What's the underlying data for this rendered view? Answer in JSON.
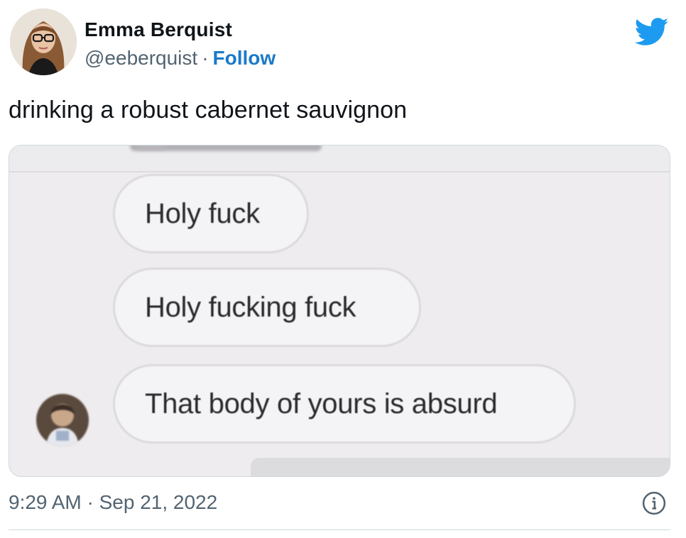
{
  "author": {
    "display_name": "Emma Berquist",
    "handle": "@eeberquist",
    "separator": "·",
    "follow_label": "Follow"
  },
  "tweet": {
    "text": "drinking a robust cabernet sauvignon",
    "timestamp": "9:29 AM · Sep 21, 2022"
  },
  "media": {
    "messages": [
      "Holy fuck",
      "Holy fucking fuck",
      "That body of yours is absurd"
    ]
  },
  "icons": {
    "brand": "twitter-bird-icon",
    "info": "info-icon"
  },
  "colors": {
    "brand_blue": "#1d9bf0",
    "link_blue": "#1b7ac9",
    "secondary_text": "#536471"
  }
}
